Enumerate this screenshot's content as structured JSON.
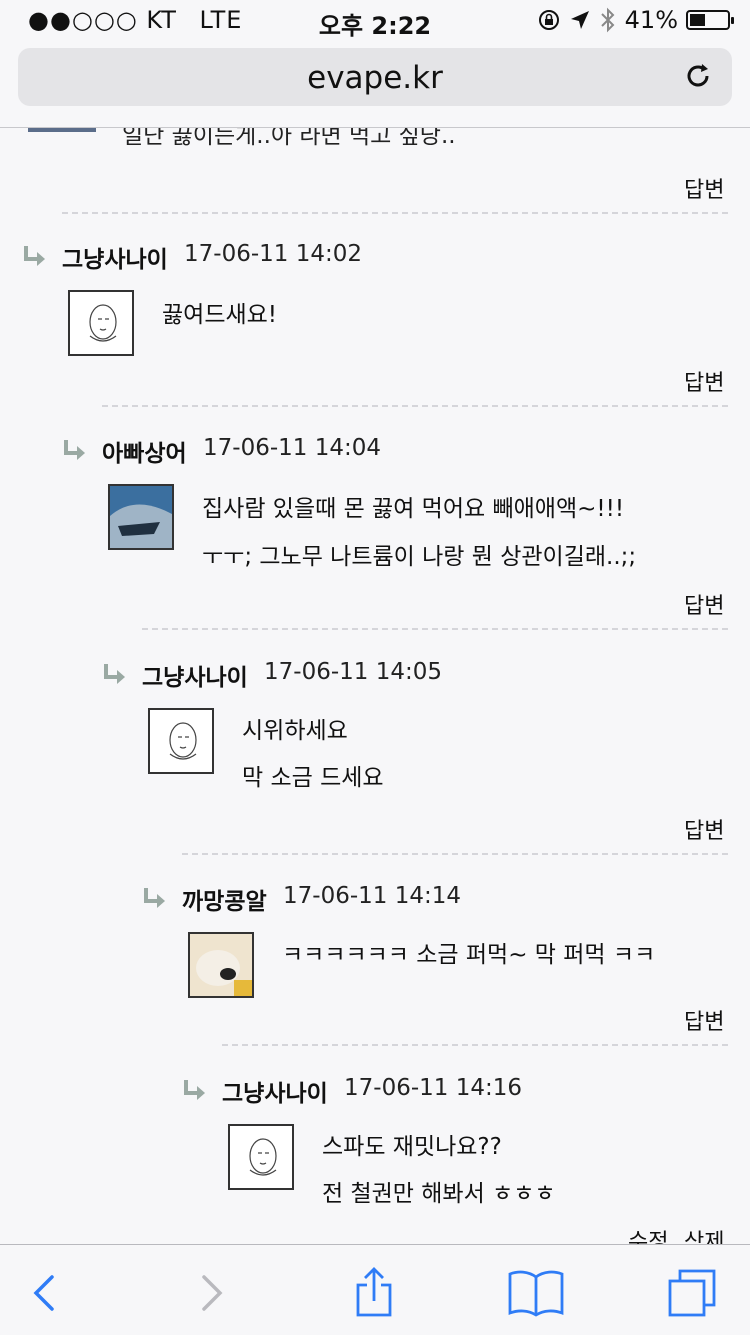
{
  "status": {
    "carrier": "●●○○○ KT",
    "network": "LTE",
    "time": "오후 2:22",
    "battery": "41%",
    "battery_level": 0.41
  },
  "urlbar": {
    "url": "evape.kr"
  },
  "top_snippet": "일단 끓이는게..아 라면 먹고 싶당..",
  "reply_label": "답변",
  "edit_label": "수정",
  "delete_label": "삭제",
  "comments": [
    {
      "author": "그냥사나이",
      "time": "17-06-11 14:02",
      "lines": [
        "끓여드새요!"
      ]
    },
    {
      "author": "아빠상어",
      "time": "17-06-11 14:04",
      "lines": [
        "집사람 있을때 몬 끓여 먹어요 빼애애액~!!!",
        "ㅜㅜ; 그노무 나트륨이 나랑 뭔 상관이길래..;;"
      ]
    },
    {
      "author": "그냥사나이",
      "time": "17-06-11 14:05",
      "lines": [
        "시위하세요",
        "막 소금 드세요"
      ]
    },
    {
      "author": "까망콩알",
      "time": "17-06-11 14:14",
      "lines": [
        "ㅋㅋㅋㅋㅋㅋ 소금 퍼먹~ 막 퍼먹 ㅋㅋ"
      ]
    },
    {
      "author": "그냥사나이",
      "time": "17-06-11 14:16",
      "lines": [
        "스파도 재밋나요??",
        "전 철권만 해봐서 ㅎㅎㅎ"
      ]
    }
  ]
}
